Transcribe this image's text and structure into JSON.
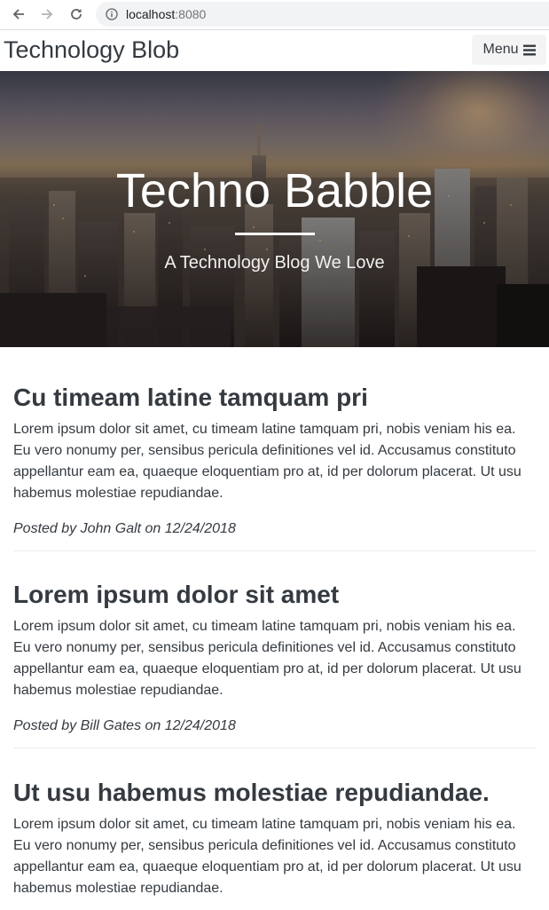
{
  "browser": {
    "url_host": "localhost",
    "url_port": ":8080",
    "icons": [
      "back-arrow-icon",
      "forward-arrow-icon",
      "reload-icon",
      "info-icon"
    ]
  },
  "navbar": {
    "brand": "Technology Blob",
    "menu_label": "Menu",
    "menu_icon": "hamburger-icon"
  },
  "hero": {
    "title": "Techno Babble",
    "subtitle": "A Technology Blog We Love"
  },
  "posts": [
    {
      "title": "Cu timeam latine tamquam pri",
      "body": "Lorem ipsum dolor sit amet, cu timeam latine tamquam pri, nobis veniam his ea. Eu vero nonumy per, sensibus pericula definitiones vel id. Accusamus constituto appellantur eam ea, quaeque eloquentiam pro at, id per dolorum placerat. Ut usu habemus molestiae repudiandae.",
      "meta": "Posted by John Galt on 12/24/2018"
    },
    {
      "title": "Lorem ipsum dolor sit amet",
      "body": "Lorem ipsum dolor sit amet, cu timeam latine tamquam pri, nobis veniam his ea. Eu vero nonumy per, sensibus pericula definitiones vel id. Accusamus constituto appellantur eam ea, quaeque eloquentiam pro at, id per dolorum placerat. Ut usu habemus molestiae repudiandae.",
      "meta": "Posted by Bill Gates on 12/24/2018"
    },
    {
      "title": "Ut usu habemus molestiae repudiandae.",
      "body": "Lorem ipsum dolor sit amet, cu timeam latine tamquam pri, nobis veniam his ea. Eu vero nonumy per, sensibus pericula definitiones vel id. Accusamus constituto appellantur eam ea, quaeque eloquentiam pro at, id per dolorum placerat. Ut usu habemus molestiae repudiandae.",
      "meta": ""
    }
  ]
}
